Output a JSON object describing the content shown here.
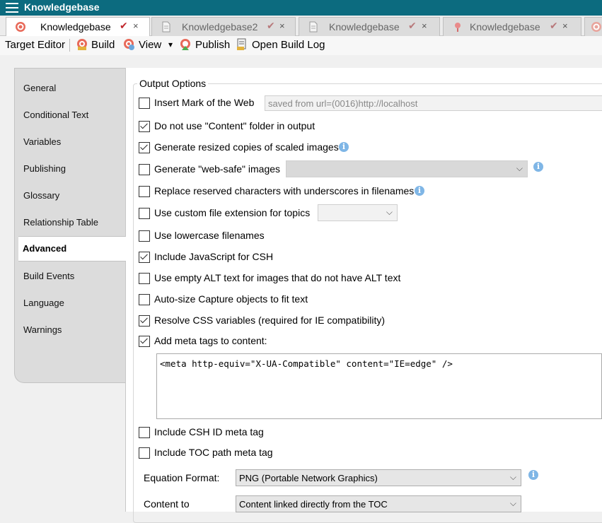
{
  "window": {
    "title": "Knowledgebase"
  },
  "tabs": [
    {
      "label": "Knowledgebase",
      "active": true,
      "icon": "target-icon"
    },
    {
      "label": "Knowledgebase2",
      "active": false,
      "icon": "document-icon"
    },
    {
      "label": "Knowledgebase",
      "active": false,
      "icon": "document-icon"
    },
    {
      "label": "Knowledgebase",
      "active": false,
      "icon": "pin-icon"
    }
  ],
  "tab_glyphs": {
    "check": "✔",
    "close": "×"
  },
  "toolbar": {
    "target_editor": "Target Editor",
    "build": "Build",
    "view": "View",
    "dropdown": "▾",
    "publish": "Publish",
    "open_build_log": "Open Build Log"
  },
  "nav": {
    "items": [
      "General",
      "Conditional Text",
      "Variables",
      "Publishing",
      "Glossary",
      "Relationship Table",
      "Advanced",
      "Build Events",
      "Language",
      "Warnings"
    ],
    "active": "Advanced"
  },
  "output_options": {
    "title": "Output Options",
    "options": [
      {
        "label": "Insert Mark of the Web",
        "checked": false
      },
      {
        "label": "Do not use \"Content\" folder in output",
        "checked": true
      },
      {
        "label": "Generate resized copies of scaled images",
        "checked": true
      },
      {
        "label": "Generate \"web-safe\" images",
        "checked": false
      },
      {
        "label": "Replace reserved characters with underscores in filenames",
        "checked": false
      },
      {
        "label": "Use custom file extension for topics",
        "checked": false
      },
      {
        "label": "Use lowercase filenames",
        "checked": false
      },
      {
        "label": "Include JavaScript for CSH",
        "checked": true
      },
      {
        "label": "Use empty ALT text for images that do not have ALT text",
        "checked": false
      },
      {
        "label": "Auto-size Capture objects to fit text",
        "checked": false
      },
      {
        "label": "Resolve CSS variables (required for IE compatibility)",
        "checked": true
      },
      {
        "label": "Add meta tags to content:",
        "checked": true
      },
      {
        "label": "Include CSH ID meta tag",
        "checked": false
      },
      {
        "label": "Include TOC path meta tag",
        "checked": false
      }
    ],
    "mark_of_web_value": "saved from url=(0016)http://localhost",
    "meta_tags_value": "<meta http-equiv=\"X-UA-Compatible\" content=\"IE=edge\" />",
    "equation_format_label": "Equation Format:",
    "equation_format_value": "PNG (Portable Network Graphics)",
    "content_to_label": "Content to",
    "content_to_value": "Content linked directly from the TOC",
    "info_glyph": "i",
    "chevron": "⌵"
  }
}
